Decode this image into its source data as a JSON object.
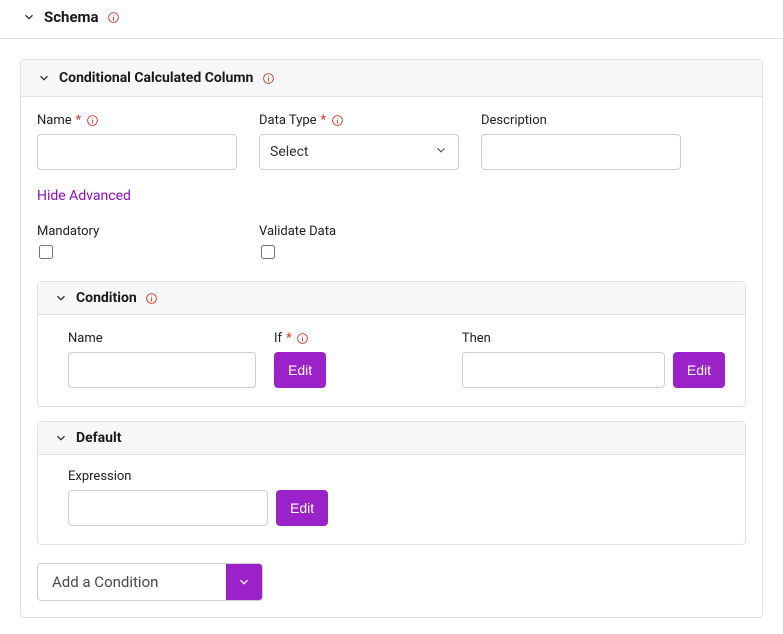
{
  "schema": {
    "title": "Schema"
  },
  "ccc": {
    "title": "Conditional Calculated Column",
    "name_label": "Name",
    "datatype_label": "Data Type",
    "datatype_selected": "Select",
    "description_label": "Description",
    "advanced_toggle": "Hide Advanced",
    "mandatory_label": "Mandatory",
    "validate_label": "Validate Data"
  },
  "condition": {
    "title": "Condition",
    "name_label": "Name",
    "if_label": "If",
    "then_label": "Then",
    "edit_label": "Edit"
  },
  "default": {
    "title": "Default",
    "expression_label": "Expression",
    "edit_label": "Edit"
  },
  "add_condition": {
    "label": "Add a Condition"
  }
}
